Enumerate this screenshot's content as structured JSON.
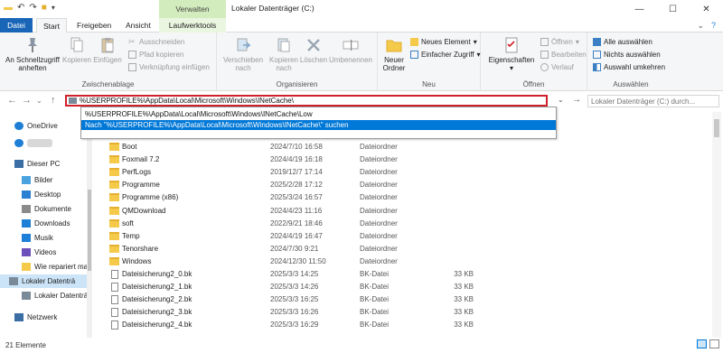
{
  "window": {
    "title": "Lokaler Datenträger (C:)",
    "context_tab_group": "Verwalten",
    "controls": [
      "—",
      "☐",
      "✕"
    ]
  },
  "tabs": [
    {
      "label": "Datei"
    },
    {
      "label": "Start"
    },
    {
      "label": "Freigeben"
    },
    {
      "label": "Ansicht"
    },
    {
      "label": "Laufwerktools"
    }
  ],
  "ribbon": {
    "groups": {
      "clipboard": "Zwischenablage",
      "organize": "Organisieren",
      "new": "Neu",
      "open": "Öffnen",
      "select": "Auswählen"
    },
    "pin": "An Schnellzugriff anheften",
    "copy": "Kopieren",
    "paste": "Einfügen",
    "cut": "Ausschneiden",
    "copy_path": "Pfad kopieren",
    "paste_shortcut": "Verknüpfung einfügen",
    "move_to": "Verschieben nach",
    "copy_to": "Kopieren nach",
    "delete": "Löschen",
    "rename": "Umbenennen",
    "new_folder": "Neuer Ordner",
    "new_item": "Neues Element",
    "easy_access": "Einfacher Zugriff",
    "properties": "Eigenschaften",
    "open": "Öffnen",
    "edit": "Bearbeiten",
    "history": "Verlauf",
    "select_all": "Alle auswählen",
    "select_none": "Nichts auswählen",
    "invert": "Auswahl umkehren"
  },
  "address": {
    "value": "%USERPROFILE%\\AppData\\Local\\Microsoft\\Windows\\INetCache\\",
    "suggestions": [
      "%USERPROFILE%\\AppData\\Local\\Microsoft\\Windows\\INetCache\\Low",
      "Nach \"%USERPROFILE%\\AppData\\Local\\Microsoft\\Windows\\INetCache\\\" suchen"
    ]
  },
  "search": {
    "placeholder": "Lokaler Datenträger (C:) durch..."
  },
  "sidebar": [
    {
      "label": "OneDrive",
      "icon": "cloud-icon",
      "color": "#1e7fd6"
    },
    {
      "label": "",
      "icon": "cloud-icon",
      "color": "#1e7fd6"
    },
    {
      "label": "Dieser PC",
      "icon": "computer-icon",
      "color": "#3b6ea5"
    },
    {
      "label": "Bilder",
      "icon": "pictures-icon",
      "color": "#4aa3df"
    },
    {
      "label": "Desktop",
      "icon": "desktop-icon",
      "color": "#2d7fd1"
    },
    {
      "label": "Dokumente",
      "icon": "documents-icon",
      "color": "#8a8a8a"
    },
    {
      "label": "Downloads",
      "icon": "download-icon",
      "color": "#1e7fd6"
    },
    {
      "label": "Musik",
      "icon": "music-icon",
      "color": "#1e7fd6"
    },
    {
      "label": "Videos",
      "icon": "video-icon",
      "color": "#6b4fbb"
    },
    {
      "label": "Wie repariert ma",
      "icon": "folder-icon",
      "color": "#f5c94a"
    },
    {
      "label": "Lokaler Datenträ",
      "icon": "drive-icon",
      "color": "#7a8a99"
    },
    {
      "label": "Lokaler Datenträ",
      "icon": "drive-icon",
      "color": "#7a8a99"
    },
    {
      "label": "Netzwerk",
      "icon": "network-icon",
      "color": "#3b6ea5"
    }
  ],
  "files": [
    {
      "name": "Boot",
      "date": "2024/7/10 16:58",
      "type": "Dateiordner",
      "size": "",
      "kind": "folder"
    },
    {
      "name": "Foxmail 7.2",
      "date": "2024/4/19 16:18",
      "type": "Dateiordner",
      "size": "",
      "kind": "folder"
    },
    {
      "name": "PerfLogs",
      "date": "2019/12/7 17:14",
      "type": "Dateiordner",
      "size": "",
      "kind": "folder"
    },
    {
      "name": "Programme",
      "date": "2025/2/28 17:12",
      "type": "Dateiordner",
      "size": "",
      "kind": "folder"
    },
    {
      "name": "Programme (x86)",
      "date": "2025/3/24 16:57",
      "type": "Dateiordner",
      "size": "",
      "kind": "folder"
    },
    {
      "name": "QMDownload",
      "date": "2024/4/23 11:16",
      "type": "Dateiordner",
      "size": "",
      "kind": "folder"
    },
    {
      "name": "soft",
      "date": "2022/9/21 18:46",
      "type": "Dateiordner",
      "size": "",
      "kind": "folder"
    },
    {
      "name": "Temp",
      "date": "2024/4/19 16:47",
      "type": "Dateiordner",
      "size": "",
      "kind": "folder"
    },
    {
      "name": "Tenorshare",
      "date": "2024/7/30 9:21",
      "type": "Dateiordner",
      "size": "",
      "kind": "folder"
    },
    {
      "name": "Windows",
      "date": "2024/12/30 11:50",
      "type": "Dateiordner",
      "size": "",
      "kind": "folder"
    },
    {
      "name": "Dateisicherung2_0.bk",
      "date": "2025/3/3 14:25",
      "type": "BK-Datei",
      "size": "33 KB",
      "kind": "file"
    },
    {
      "name": "Dateisicherung2_1.bk",
      "date": "2025/3/3 14:26",
      "type": "BK-Datei",
      "size": "33 KB",
      "kind": "file"
    },
    {
      "name": "Dateisicherung2_2.bk",
      "date": "2025/3/3 16:25",
      "type": "BK-Datei",
      "size": "33 KB",
      "kind": "file"
    },
    {
      "name": "Dateisicherung2_3.bk",
      "date": "2025/3/3 16:26",
      "type": "BK-Datei",
      "size": "33 KB",
      "kind": "file"
    },
    {
      "name": "Dateisicherung2_4.bk",
      "date": "2025/3/3 16:29",
      "type": "BK-Datei",
      "size": "33 KB",
      "kind": "file"
    }
  ],
  "status": {
    "count": "21 Elemente"
  },
  "colors": {
    "accent": "#0078d7",
    "file_tab": "#1966b8",
    "context_tab": "#d3ecbd",
    "highlight_border": "#d0202a"
  }
}
